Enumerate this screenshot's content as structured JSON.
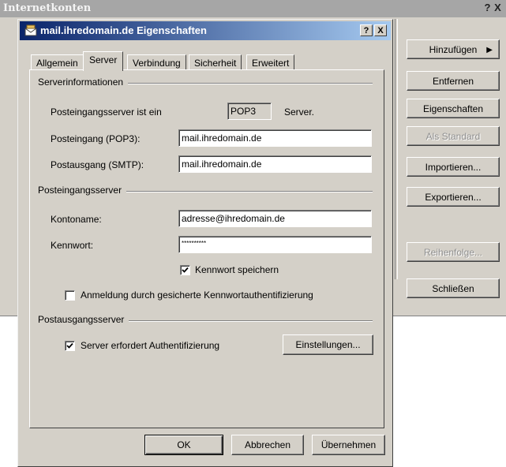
{
  "background_window": {
    "title": "Internetkonten",
    "buttons": {
      "help": "?",
      "close": "X",
      "add": "Hinzufügen",
      "remove": "Entfernen",
      "properties": "Eigenschaften",
      "set_default": "Als Standard",
      "import": "Importieren...",
      "export": "Exportieren...",
      "order": "Reihenfolge...",
      "close_dialog": "Schließen"
    }
  },
  "dialog": {
    "title": "mail.ihredomain.de Eigenschaften",
    "help": "?",
    "close": "X",
    "tabs": [
      "Allgemein",
      "Server",
      "Verbindung",
      "Sicherheit",
      "Erweitert"
    ],
    "active_tab": "Server",
    "server_info": {
      "group_label": "Serverinformationen",
      "incoming_type_label": "Posteingangsserver ist ein",
      "incoming_type_value": "POP3",
      "incoming_type_suffix": "Server.",
      "incoming_label": "Posteingang (POP3):",
      "incoming_value": "mail.ihredomain.de",
      "outgoing_label": "Postausgang (SMTP):",
      "outgoing_value": "mail.ihredomain.de"
    },
    "incoming_server": {
      "group_label": "Posteingangsserver",
      "account_label": "Kontoname:",
      "account_value": "adresse@ihredomain.de",
      "password_label": "Kennwort:",
      "password_value": "**********",
      "save_password_label": "Kennwort speichern",
      "save_password_checked": true,
      "spa_label": "Anmeldung durch gesicherte Kennwortauthentifizierung",
      "spa_checked": false
    },
    "outgoing_server": {
      "group_label": "Postausgangsserver",
      "auth_label": "Server erfordert Authentifizierung",
      "auth_checked": true,
      "settings_button": "Einstellungen..."
    },
    "footer": {
      "ok": "OK",
      "cancel": "Abbrechen",
      "apply": "Übernehmen"
    }
  }
}
